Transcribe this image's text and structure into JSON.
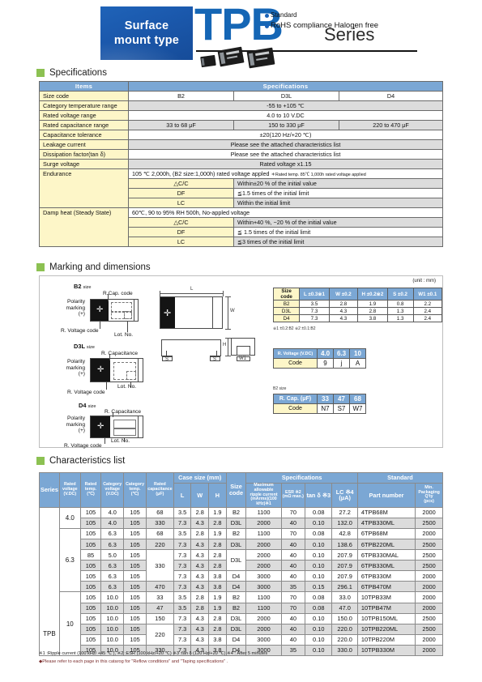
{
  "header": {
    "badge_line1": "Surface",
    "badge_line2": "mount type",
    "product": "TPB",
    "series": "Series",
    "bullet1": "Standard",
    "bullet2": "RoHS compliance  Halogen free"
  },
  "sections": {
    "specifications": "Specifications",
    "marking": "Marking and dimensions",
    "characteristics": "Characteristics list"
  },
  "spec_table": {
    "col_items": "Items",
    "col_specs": "Specifications",
    "rows": {
      "size_code_label": "Size code",
      "size_codes": [
        "B2",
        "D3L",
        "D4"
      ],
      "category_temp_label": "Category temperature range",
      "category_temp_value": "-55 to +105 ℃",
      "rated_voltage_label": "Rated voltage range",
      "rated_voltage_value": "4.0 to 10  V.DC",
      "rated_cap_label": "Rated capacitance range",
      "rated_cap_values": [
        "33 to 68 μF",
        "150 to 330 μF",
        "220 to 470 μF"
      ],
      "cap_tol_label": "Capacitance tolerance",
      "cap_tol_value": "±20(120 Hz/+20 ℃)",
      "leakage_label": "Leakage current",
      "leakage_value": "Please see the attached characteristics list",
      "df_label": "Dissipation factor(tan δ)",
      "df_value": "Please see the attached characteristics list",
      "surge_label": "Surge voltage",
      "surge_value": "Rated voltage x1.15",
      "endurance_label": "Endurance",
      "endurance_value": "105 ℃ 2,000h, (B2 size:1,000h) rated voltage appled",
      "endurance_note": "＊Rated temp. 85℃ 1,000h rated voltage applied",
      "end_dcc_label": "△C/C",
      "end_dcc_value": "Within±20 % of the initial value",
      "end_df_label": "DF",
      "end_df_value": "≦1.5 times of the initial limit",
      "end_lc_label": "LC",
      "end_lc_value": "Within the initial limit",
      "damp_label": "Damp heat (Steady State)",
      "damp_value": "60℃, 90 to 95% RH 500h, No-appled voltage",
      "damp_dcc_label": "△C/C",
      "damp_dcc_value": "Within+40 %, −20 % of the initial value",
      "damp_df_label": "DF",
      "damp_df_value": "≦ 1.5 times of the initial limit",
      "damp_lc_label": "LC",
      "damp_lc_value": "≦3 times of the initial limit"
    }
  },
  "marking": {
    "unit": "(unit : mm)",
    "b2": {
      "size": "B2",
      "size_suffix": "size",
      "cap_code": "R.Cap. code",
      "polarity": "Polarity\nmarking\n(+)",
      "polarity_l1": "Polarity",
      "polarity_l2": "marking",
      "polarity_l3": "(+)",
      "voltage_code": "R. Voltage code",
      "lot": "Lot. No."
    },
    "d3l": {
      "size": "D3L",
      "size_suffix": "size",
      "capacitance": "R. Capacitance",
      "polarity_l1": "Polarity",
      "polarity_l2": "marking",
      "polarity_l3": "(+)",
      "voltage_code": "R. Voltage code",
      "lot": "Lot. No."
    },
    "d4": {
      "size": "D4",
      "size_suffix": "size",
      "capacitance": "R. Capacitance",
      "polarity_l1": "Polarity",
      "polarity_l2": "marking",
      "polarity_l3": "(+)",
      "voltage_code": "R. Voltage code",
      "lot": "Lot. No."
    },
    "drawing_labels": {
      "L": "L",
      "W": "W",
      "H": "H",
      "S1": "S",
      "S2": "S",
      "W1": "W1"
    },
    "dim_table": {
      "headers": [
        "Size code",
        "L ±0.3※1",
        "W ±0.2",
        "H ±0.2※2",
        "S ±0.2",
        "W1 ±0.1"
      ],
      "rows": [
        [
          "B2",
          "3.5",
          "2.8",
          "1.9",
          "0.8",
          "2.2"
        ],
        [
          "D3L",
          "7.3",
          "4.3",
          "2.8",
          "1.3",
          "2.4"
        ],
        [
          "D4",
          "7.3",
          "4.3",
          "3.8",
          "1.3",
          "2.4"
        ]
      ],
      "note": "※1 ±0.2:B2  ※2 ±0.1:B2"
    },
    "voltage_code_table": {
      "header": "R. Voltage (V.DC)",
      "values": [
        "4.0",
        "6.3",
        "10"
      ],
      "code_label": "Code",
      "codes": [
        "9",
        "j",
        "A"
      ]
    },
    "cap_code_table": {
      "caption": "B2 size",
      "header": "R. Cap. (μF)",
      "values": [
        "33",
        "47",
        "68"
      ],
      "code_label": "Code",
      "codes": [
        "N7",
        "S7",
        "W7"
      ]
    }
  },
  "chars_table": {
    "headers": {
      "series": "Series",
      "rated_voltage": "Rated voltage (V.DC)",
      "rated_voltage_l": [
        "Rated",
        "voltage",
        "(V.DC)"
      ],
      "rated_temp_l": [
        "Rated",
        "temp.",
        "(℃)"
      ],
      "category_voltage_l": [
        "Category",
        "voltage",
        "(V.DC)"
      ],
      "category_temp_l": [
        "Category",
        "temp.",
        "(℃)"
      ],
      "rated_cap_l": [
        "Rated",
        "capacitance",
        "(μF)"
      ],
      "case_size": "Case size (mm)",
      "case_L": "L",
      "case_W": "W",
      "case_H": "H",
      "size_code_l": [
        "Size",
        "code"
      ],
      "specifications": "Specifications",
      "ripple_l": [
        "Maximum allowable",
        "ripple current",
        "(mArms)(100 kHz)※1"
      ],
      "esr_l": [
        "ESR ※2",
        "(mΩ max.)"
      ],
      "tand": "tan δ ※3",
      "lc_l": [
        "LC ※4",
        "(μA)"
      ],
      "standard": "Standard",
      "part_number": "Part number",
      "packaging_l": [
        "Min. Packaging Q'ty",
        "(pcs)"
      ]
    },
    "series_label": "TPB",
    "rows": [
      {
        "group": "4.0",
        "rated_temp": "105",
        "cat_voltage": "4.0",
        "cat_temp": "105",
        "cap": "68",
        "L": "3.5",
        "W": "2.8",
        "H": "1.9",
        "size": "B2",
        "ripple": "1100",
        "esr": "70",
        "tand": "0.08",
        "lc": "27.2",
        "pn": "4TPB68M",
        "qty": "2000"
      },
      {
        "group": "4.0",
        "rated_temp": "105",
        "cat_voltage": "4.0",
        "cat_temp": "105",
        "cap": "330",
        "L": "7.3",
        "W": "4.3",
        "H": "2.8",
        "size": "D3L",
        "ripple": "2000",
        "esr": "40",
        "tand": "0.10",
        "lc": "132.0",
        "pn": "4TPB330ML",
        "qty": "2500"
      },
      {
        "group": "6.3",
        "rated_temp": "105",
        "cat_voltage": "6.3",
        "cat_temp": "105",
        "cap": "68",
        "L": "3.5",
        "W": "2.8",
        "H": "1.9",
        "size": "B2",
        "ripple": "1100",
        "esr": "70",
        "tand": "0.08",
        "lc": "42.8",
        "pn": "6TPB68M",
        "qty": "2000"
      },
      {
        "group": "6.3",
        "rated_temp": "105",
        "cat_voltage": "6.3",
        "cat_temp": "105",
        "cap": "220",
        "L": "7.3",
        "W": "4.3",
        "H": "2.8",
        "size": "D3L",
        "ripple": "2000",
        "esr": "40",
        "tand": "0.10",
        "lc": "138.6",
        "pn": "6TPB220ML",
        "qty": "2500"
      },
      {
        "group": "6.3",
        "rated_temp": "85",
        "cat_voltage": "5.0",
        "cat_temp": "105",
        "cap": "330",
        "L": "7.3",
        "W": "4.3",
        "H": "2.8",
        "size": "D3L",
        "ripple": "2000",
        "esr": "40",
        "tand": "0.10",
        "lc": "207.9",
        "pn": "6TPB330MAL",
        "qty": "2500"
      },
      {
        "group": "6.3",
        "rated_temp": "105",
        "cat_voltage": "6.3",
        "cat_temp": "105",
        "cap": "330",
        "L": "7.3",
        "W": "4.3",
        "H": "2.8",
        "size": "D3L",
        "ripple": "2000",
        "esr": "40",
        "tand": "0.10",
        "lc": "207.9",
        "pn": "6TPB330ML",
        "qty": "2500"
      },
      {
        "group": "6.3",
        "rated_temp": "105",
        "cat_voltage": "6.3",
        "cat_temp": "105",
        "cap": "330",
        "L": "7.3",
        "W": "4.3",
        "H": "3.8",
        "size": "D4",
        "ripple": "3000",
        "esr": "40",
        "tand": "0.10",
        "lc": "207.9",
        "pn": "6TPB330M",
        "qty": "2000"
      },
      {
        "group": "6.3",
        "rated_temp": "105",
        "cat_voltage": "6.3",
        "cat_temp": "105",
        "cap": "470",
        "L": "7.3",
        "W": "4.3",
        "H": "3.8",
        "size": "D4",
        "ripple": "3000",
        "esr": "35",
        "tand": "0.15",
        "lc": "296.1",
        "pn": "6TPB470M",
        "qty": "2000"
      },
      {
        "group": "10",
        "rated_temp": "105",
        "cat_voltage": "10.0",
        "cat_temp": "105",
        "cap": "33",
        "L": "3.5",
        "W": "2.8",
        "H": "1.9",
        "size": "B2",
        "ripple": "1100",
        "esr": "70",
        "tand": "0.08",
        "lc": "33.0",
        "pn": "10TPB33M",
        "qty": "2000"
      },
      {
        "group": "10",
        "rated_temp": "105",
        "cat_voltage": "10.0",
        "cat_temp": "105",
        "cap": "47",
        "L": "3.5",
        "W": "2.8",
        "H": "1.9",
        "size": "B2",
        "ripple": "1100",
        "esr": "70",
        "tand": "0.08",
        "lc": "47.0",
        "pn": "10TPB47M",
        "qty": "2000"
      },
      {
        "group": "10",
        "rated_temp": "105",
        "cat_voltage": "10.0",
        "cat_temp": "105",
        "cap": "150",
        "L": "7.3",
        "W": "4.3",
        "H": "2.8",
        "size": "D3L",
        "ripple": "2000",
        "esr": "40",
        "tand": "0.10",
        "lc": "150.0",
        "pn": "10TPB150ML",
        "qty": "2500"
      },
      {
        "group": "10",
        "rated_temp": "105",
        "cat_voltage": "10.0",
        "cat_temp": "105",
        "cap": "220",
        "L": "7.3",
        "W": "4.3",
        "H": "2.8",
        "size": "D3L",
        "ripple": "2000",
        "esr": "40",
        "tand": "0.10",
        "lc": "220.0",
        "pn": "10TPB220ML",
        "qty": "2500"
      },
      {
        "group": "10",
        "rated_temp": "105",
        "cat_voltage": "10.0",
        "cat_temp": "105",
        "cap": "220",
        "L": "7.3",
        "W": "4.3",
        "H": "3.8",
        "size": "D4",
        "ripple": "3000",
        "esr": "40",
        "tand": "0.10",
        "lc": "220.0",
        "pn": "10TPB220M",
        "qty": "2000"
      },
      {
        "group": "10",
        "rated_temp": "105",
        "cat_voltage": "10.0",
        "cat_temp": "105",
        "cap": "330",
        "L": "7.3",
        "W": "4.3",
        "H": "3.8",
        "size": "D4",
        "ripple": "3000",
        "esr": "35",
        "tand": "0.10",
        "lc": "330.0",
        "pn": "10TPB330M",
        "qty": "2000"
      }
    ]
  },
  "footnotes": {
    "line1": "※1 :Ripple current (100 kHz/ +45 ℃ ), ※2 :ESR (100 kHz/+20 ℃)   ※3 :tan δ (120 Hz/+20 ℃)   ※4 : After 5 minutes",
    "line2": "◆Please refer to each page in this catarog for \"Reflow conditions\" and \"Taping specifications\" ."
  },
  "colors": {
    "header_blue": "#7ba7d4",
    "brand_blue": "#1566b5",
    "label_yellow": "#fdf6c8",
    "value_gray": "#dcdcdc",
    "accent_green": "#8cc152"
  }
}
